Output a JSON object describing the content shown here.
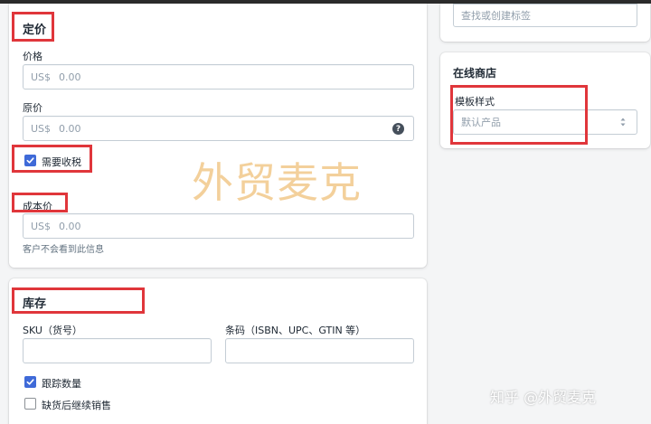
{
  "pricing": {
    "title": "定价",
    "price": {
      "label": "价格",
      "prefix": "US$",
      "value": "0.00"
    },
    "compare_price": {
      "label": "原价",
      "prefix": "US$",
      "value": "0.00",
      "help_glyph": "?"
    },
    "tax": {
      "label": "需要收税",
      "checked": true
    },
    "cost": {
      "label": "成本价",
      "prefix": "US$",
      "value": "0.00",
      "help": "客户不会看到此信息"
    }
  },
  "inventory": {
    "title": "库存",
    "sku": {
      "label": "SKU（货号）",
      "value": ""
    },
    "barcode": {
      "label": "条码（ISBN、UPC、GTIN 等）",
      "value": ""
    },
    "track_quantity": {
      "label": "跟踪数量",
      "checked": true
    },
    "continue_selling": {
      "label": "缺货后继续销售",
      "checked": false
    }
  },
  "tags": {
    "placeholder": "查找或创建标签"
  },
  "online_store": {
    "title": "在线商店",
    "template": {
      "label": "模板样式",
      "value": "默认产品"
    }
  },
  "watermark": "外贸麦克",
  "credit": "知乎 @外贸麦克",
  "icons": {
    "help": "question-circle-icon",
    "checkbox": "checkmark-icon",
    "select": "select-arrows-icon"
  },
  "colors": {
    "accent": "#3f6ad8",
    "highlight_box": "#e0363b",
    "watermark": "#f1c88a"
  }
}
